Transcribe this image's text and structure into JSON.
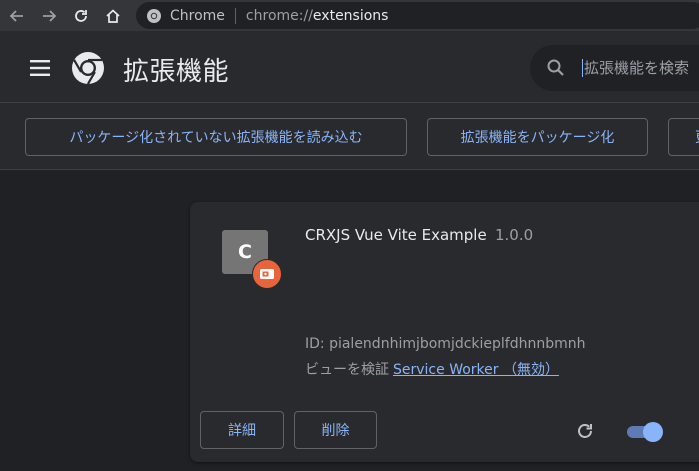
{
  "browser": {
    "site_name": "Chrome",
    "url_scheme": "chrome://",
    "url_host": "extensions"
  },
  "header": {
    "title": "拡張機能",
    "search_placeholder": "拡張機能を検索"
  },
  "toolbar": {
    "load_unpacked_label": "パッケージ化されていない拡張機能を読み込む",
    "pack_label": "拡張機能をパッケージ化",
    "update_label": "更"
  },
  "extension": {
    "icon_letter": "C",
    "name": "CRXJS Vue Vite Example",
    "version": "1.0.0",
    "id": "ID: pialendnhimjbomjdckieplfdhnnbmnh",
    "inspect_views_label": "ビューを検証",
    "inspect_link": "Service Worker （無効）",
    "details_label": "詳細",
    "remove_label": "削除",
    "enabled": true
  },
  "colors": {
    "accent": "#8ab4f8",
    "background": "#202124",
    "surface": "#292a2d",
    "badge": "#e8643d"
  }
}
